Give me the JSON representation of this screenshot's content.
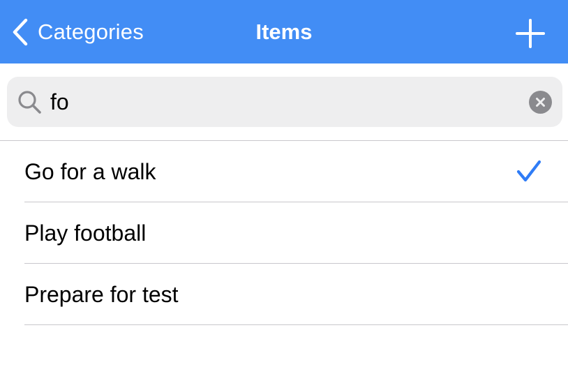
{
  "navbar": {
    "back_label": "Categories",
    "title": "Items",
    "back_icon": "chevron-left-icon",
    "add_icon": "plus-icon",
    "background_color": "#428DF5"
  },
  "search": {
    "value": "fo",
    "placeholder": "Search",
    "search_icon": "magnifying-glass-icon",
    "clear_icon": "clear-circle-icon"
  },
  "items": [
    {
      "label": "Go for a walk",
      "checked": true
    },
    {
      "label": "Play football",
      "checked": false
    },
    {
      "label": "Prepare for test",
      "checked": false
    }
  ],
  "colors": {
    "accent": "#428DF5",
    "checkmark": "#2F7CF6",
    "separator": "#C8C7CC",
    "search_background": "#EEEEEF"
  }
}
